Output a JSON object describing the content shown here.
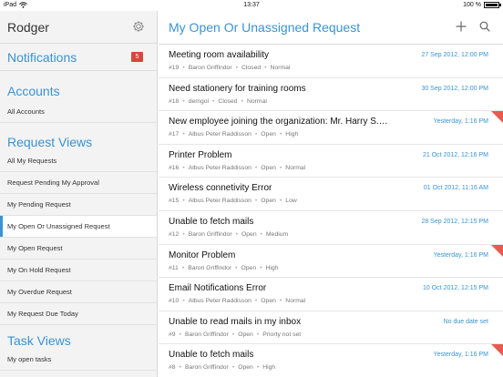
{
  "status": {
    "device": "iPad",
    "time": "13:37",
    "battery": "100 %"
  },
  "sidebar": {
    "user": "Rodger",
    "notifications": {
      "label": "Notifications",
      "count": "5"
    },
    "accounts": {
      "heading": "Accounts",
      "items": [
        "All Accounts"
      ]
    },
    "request_views": {
      "heading": "Request Views",
      "items": [
        "All My Requests",
        "Request Pending My Approval",
        "My Pending Request",
        "My Open Or Unassigned Request",
        "My Open Request",
        "My On Hold Request",
        "My Overdue Request",
        "My Request Due Today"
      ],
      "active_index": 3
    },
    "task_views": {
      "heading": "Task Views",
      "items": [
        "My open tasks"
      ]
    }
  },
  "main": {
    "title": "My Open Or Unassigned Request",
    "requests": [
      {
        "title": "Meeting room availability",
        "date": "27 Sep 2012, 12:00 PM",
        "id": "#19",
        "user": "Baron Griffindor",
        "status": "Closed",
        "priority": "Normal",
        "flag": false
      },
      {
        "title": "Need stationery for training rooms",
        "date": "30 Sep 2012, 12:00 PM",
        "id": "#18",
        "user": "demgol",
        "status": "Closed",
        "priority": "Normal",
        "flag": false
      },
      {
        "title": "New employee joining the organization: Mr. Harry S.…",
        "date": "Yesterday, 1:16 PM",
        "id": "#17",
        "user": "Albus Peter Raddisson",
        "status": "Open",
        "priority": "High",
        "flag": true
      },
      {
        "title": "Printer Problem",
        "date": "21 Oct 2012, 12:16 PM",
        "id": "#16",
        "user": "Albus Peter Raddisson",
        "status": "Open",
        "priority": "Normal",
        "flag": false
      },
      {
        "title": "Wireless connetivity Error",
        "date": "01 Oct 2012, 11:16 AM",
        "id": "#15",
        "user": "Albus Peter Raddisson",
        "status": "Open",
        "priority": "Low",
        "flag": false
      },
      {
        "title": "Unable to fetch mails",
        "date": "28 Sep 2012, 12:15 PM",
        "id": "#12",
        "user": "Baron Griffindor",
        "status": "Open",
        "priority": "Medium",
        "flag": false
      },
      {
        "title": "Monitor Problem",
        "date": "Yesterday, 1:16 PM",
        "id": "#11",
        "user": "Baron Griffindor",
        "status": "Open",
        "priority": "High",
        "flag": true
      },
      {
        "title": "Email Notifications Error",
        "date": "10 Oct 2012, 12:15 PM",
        "id": "#10",
        "user": "Albus Peter Raddisson",
        "status": "Open",
        "priority": "Normal",
        "flag": false
      },
      {
        "title": "Unable to read mails in my inbox",
        "date": "No due date set",
        "id": "#9",
        "user": "Baron Griffindor",
        "status": "Open",
        "priority": "Priorty not set",
        "flag": false
      },
      {
        "title": "Unable to fetch mails",
        "date": "Yesterday, 1:16 PM",
        "id": "#8",
        "user": "Baron Griffindor",
        "status": "Open",
        "priority": "High",
        "flag": true
      }
    ]
  },
  "colors": {
    "accent": "#3a93d2",
    "badge": "#d9463c",
    "flag": "#e85a50"
  },
  "icons": {
    "settings": "gear-icon",
    "add": "plus-icon",
    "search": "search-icon"
  }
}
